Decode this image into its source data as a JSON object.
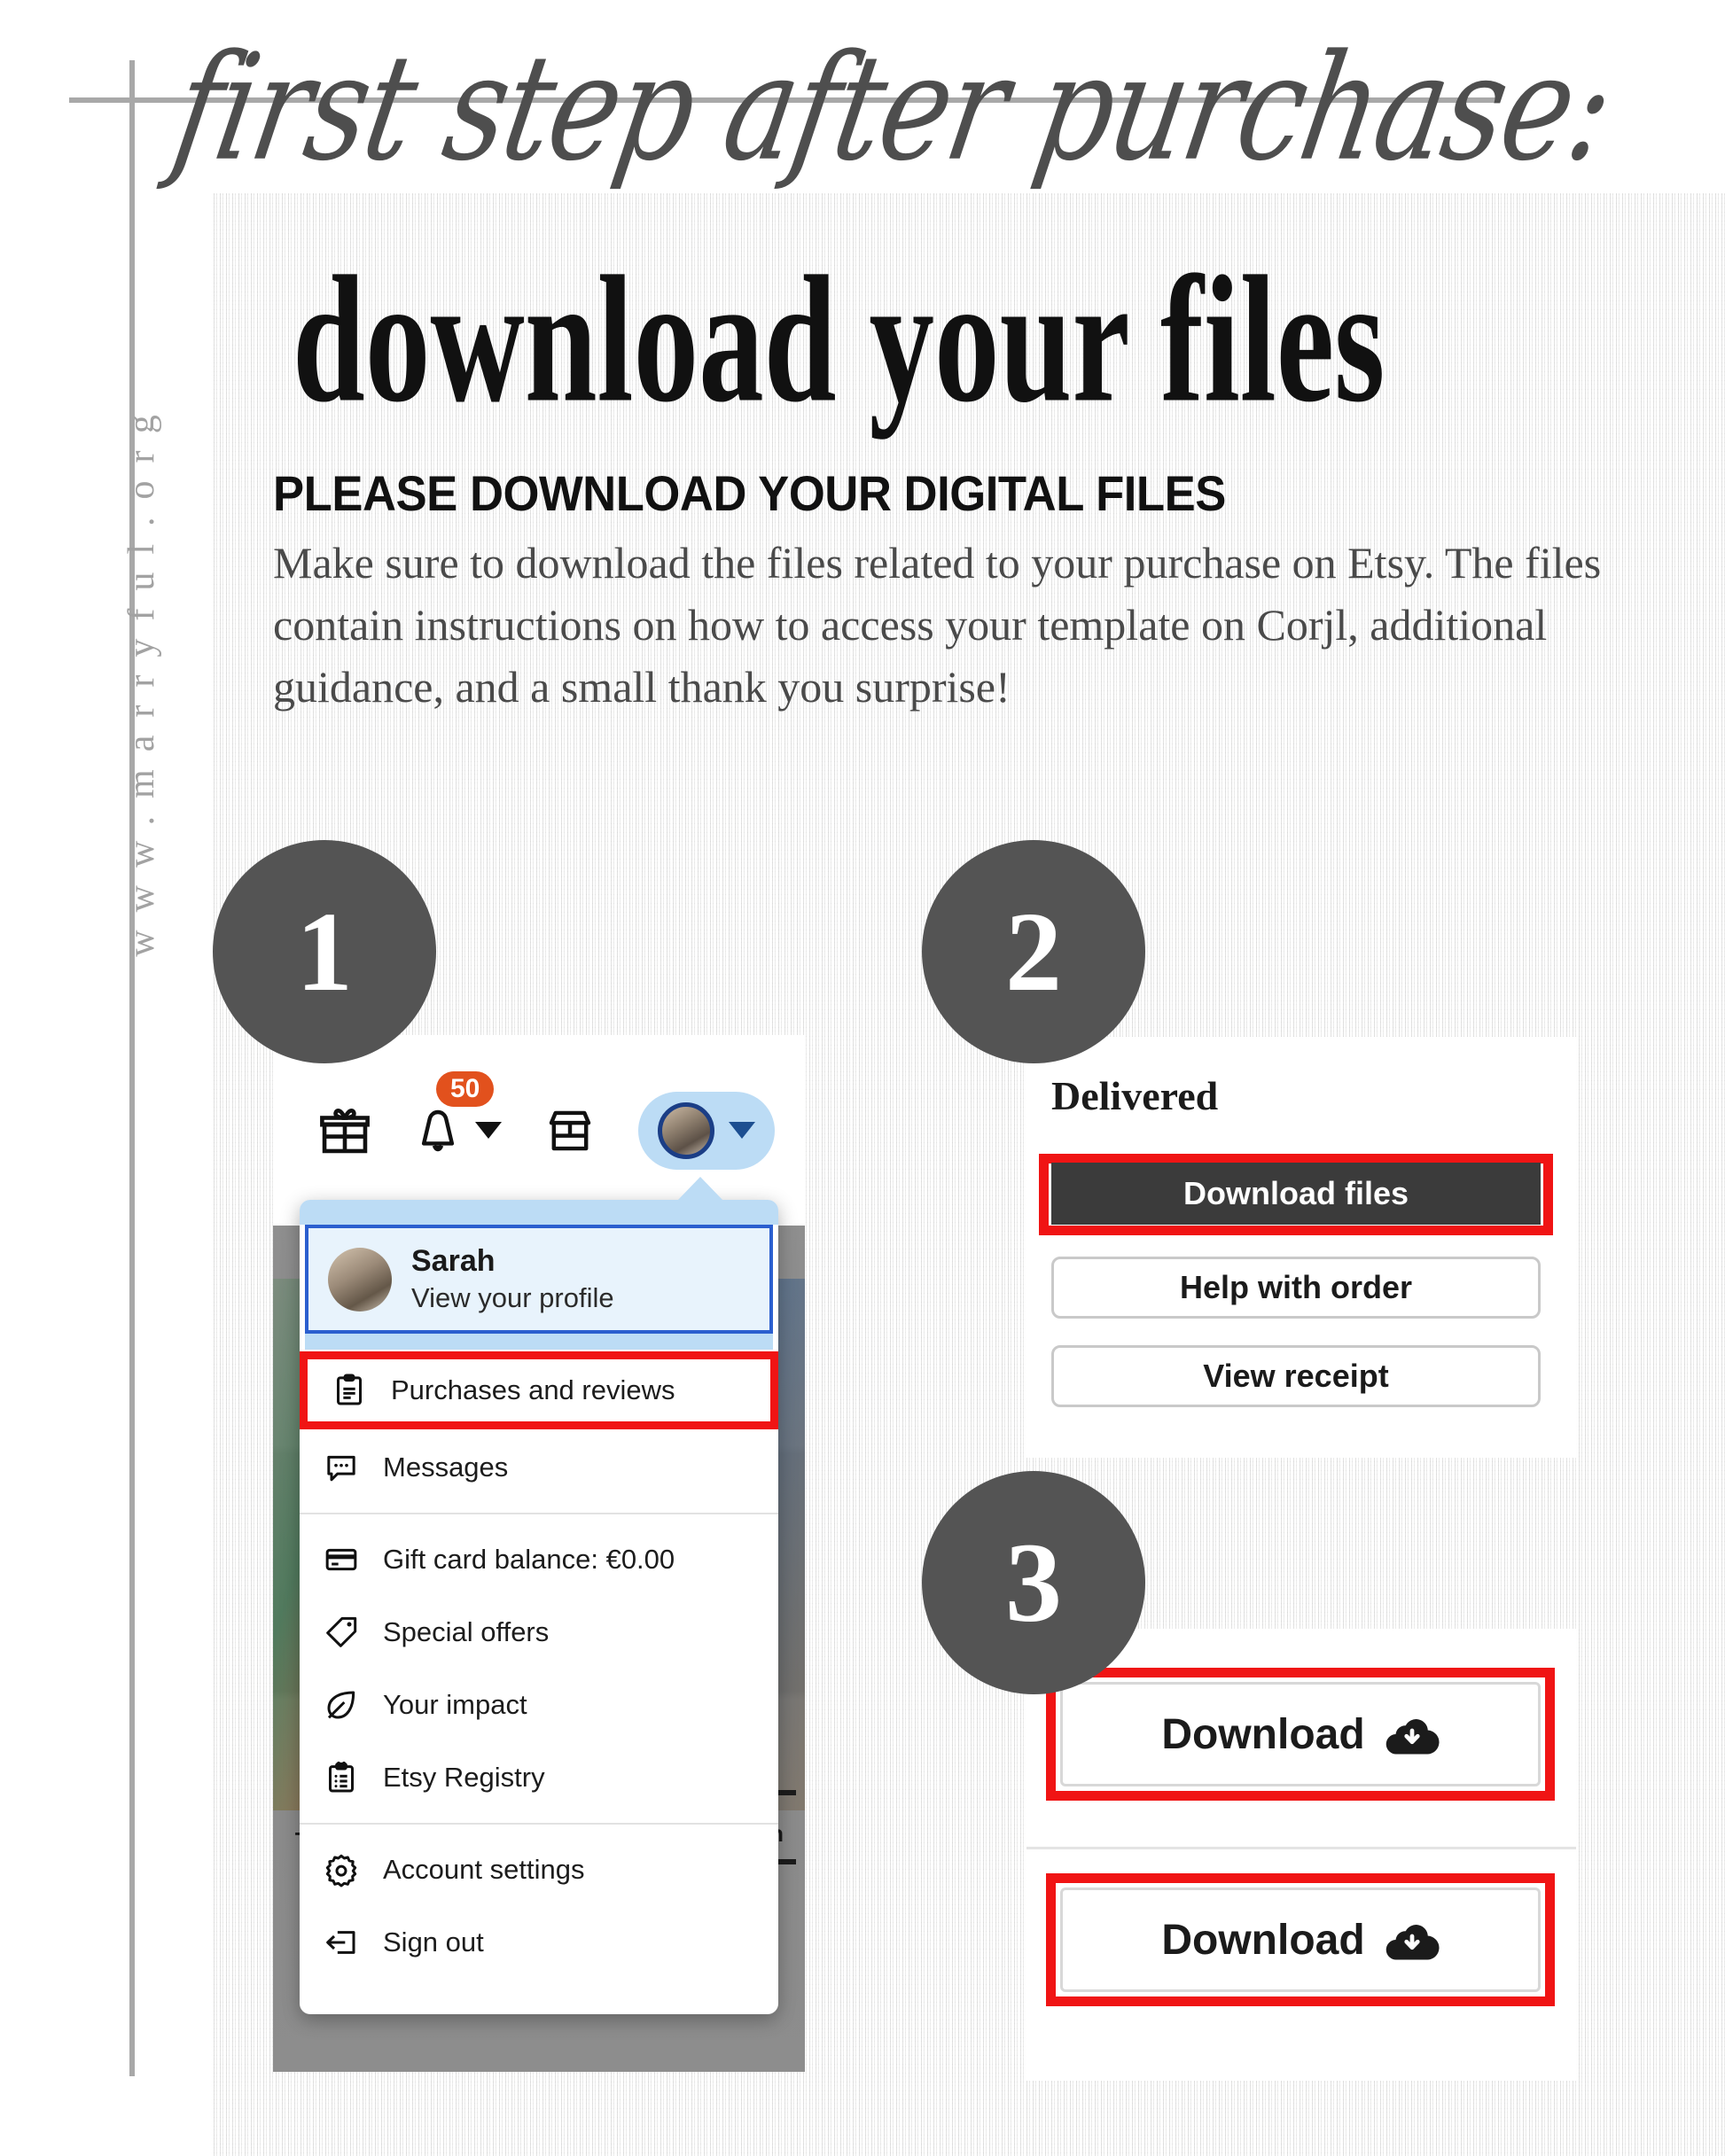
{
  "branding": {
    "vertical_url": "www.marryful.org"
  },
  "header": {
    "script_line": "first step after purchase:",
    "main_title": "download your files"
  },
  "intro": {
    "subheading": "PLEASE DOWNLOAD YOUR DIGITAL FILES",
    "paragraph": "Make sure to download the files related to your purchase on Etsy. The files contain instructions on how to access your template on Corjl, additional guidance, and a small thank you surprise!"
  },
  "colors": {
    "highlight_red": "#f01414",
    "step_circle": "#545454",
    "etsy_orange": "#E2511D",
    "profile_blue": "#2b5fcf",
    "avatar_pill_blue": "#bcdcf5",
    "dark_button": "#3b3b3b"
  },
  "steps": [
    {
      "number": "1"
    },
    {
      "number": "2"
    },
    {
      "number": "3"
    }
  ],
  "step1": {
    "notification_count": "50",
    "icons": [
      "gift-icon",
      "bell-icon",
      "shop-icon",
      "avatar-icon"
    ],
    "profile": {
      "name": "Sarah",
      "subtitle": "View your profile"
    },
    "menu_items": [
      {
        "label": "Purchases and reviews",
        "icon": "clipboard-icon",
        "highlighted": true
      },
      {
        "label": "Messages",
        "icon": "message-bubble-icon",
        "highlighted": false
      },
      {
        "label": "Gift card balance: €0.00",
        "icon": "credit-card-icon",
        "highlighted": false
      },
      {
        "label": "Special offers",
        "icon": "price-tag-icon",
        "highlighted": false
      },
      {
        "label": "Your impact",
        "icon": "leaf-icon",
        "highlighted": false
      },
      {
        "label": "Etsy Registry",
        "icon": "registry-clipboard-icon",
        "highlighted": false
      },
      {
        "label": "Account settings",
        "icon": "gear-icon",
        "highlighted": false
      },
      {
        "label": "Sign out",
        "icon": "sign-out-icon",
        "highlighted": false
      }
    ],
    "background_fragments": {
      "left": "+ n",
      "right": "an"
    }
  },
  "step2": {
    "status": "Delivered",
    "buttons": [
      {
        "label": "Download files",
        "style": "dark",
        "highlighted": true
      },
      {
        "label": "Help with order",
        "style": "light",
        "highlighted": false
      },
      {
        "label": "View receipt",
        "style": "light",
        "highlighted": false
      }
    ]
  },
  "step3": {
    "buttons": [
      {
        "label": "Download",
        "icon": "cloud-download-icon",
        "highlighted": true
      },
      {
        "label": "Download",
        "icon": "cloud-download-icon",
        "highlighted": true
      }
    ]
  }
}
